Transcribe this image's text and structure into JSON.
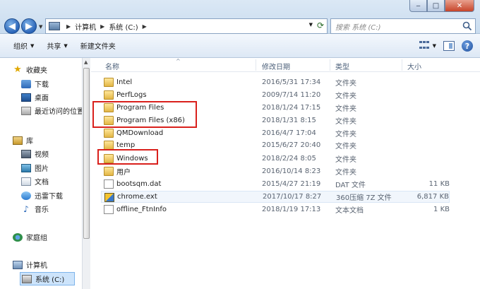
{
  "window": {
    "min_glyph": "‒",
    "max_glyph": "□",
    "close_glyph": "✕"
  },
  "address": {
    "crumbs": [
      "计算机",
      "系统 (C:)"
    ]
  },
  "search": {
    "placeholder": "搜索 系统 (C:)"
  },
  "toolbar": {
    "organize": "组织",
    "share": "共享",
    "new_folder": "新建文件夹"
  },
  "nav": {
    "favorites": "收藏夹",
    "downloads": "下载",
    "desktop": "桌面",
    "recent": "最近访问的位置",
    "libraries": "库",
    "videos": "视频",
    "pictures": "图片",
    "documents": "文档",
    "thunder": "迅雷下载",
    "music": "音乐",
    "homegroup": "家庭组",
    "computer": "计算机",
    "drive_c": "系统 (C:)"
  },
  "columns": {
    "name": "名称",
    "date": "修改日期",
    "type": "类型",
    "size": "大小"
  },
  "files": [
    {
      "name": "Intel",
      "date": "2016/5/31 17:34",
      "type": "文件夹",
      "size": "",
      "icon": "folder-icon"
    },
    {
      "name": "PerfLogs",
      "date": "2009/7/14 11:20",
      "type": "文件夹",
      "size": "",
      "icon": "folder-icon"
    },
    {
      "name": "Program Files",
      "date": "2018/1/24 17:15",
      "type": "文件夹",
      "size": "",
      "icon": "folder-icon"
    },
    {
      "name": "Program Files (x86)",
      "date": "2018/1/31 8:15",
      "type": "文件夹",
      "size": "",
      "icon": "folder-icon"
    },
    {
      "name": "QMDownload",
      "date": "2016/4/7 17:04",
      "type": "文件夹",
      "size": "",
      "icon": "folder-icon"
    },
    {
      "name": "temp",
      "date": "2015/6/27 20:40",
      "type": "文件夹",
      "size": "",
      "icon": "folder-icon"
    },
    {
      "name": "Windows",
      "date": "2018/2/24 8:05",
      "type": "文件夹",
      "size": "",
      "icon": "folder-icon"
    },
    {
      "name": "用户",
      "date": "2016/10/14 8:23",
      "type": "文件夹",
      "size": "",
      "icon": "folder-icon"
    },
    {
      "name": "bootsqm.dat",
      "date": "2015/4/27 21:19",
      "type": "DAT 文件",
      "size": "11 KB",
      "icon": "file-icon"
    },
    {
      "name": "chrome.ext",
      "date": "2017/10/17 8:27",
      "type": "360压缩 7Z 文件",
      "size": "6,817 KB",
      "icon": "archive-icon"
    },
    {
      "name": "offline_FtnInfo",
      "date": "2018/1/19 17:13",
      "type": "文本文档",
      "size": "1 KB",
      "icon": "file-icon"
    }
  ],
  "highlight_color": "#d9201c"
}
